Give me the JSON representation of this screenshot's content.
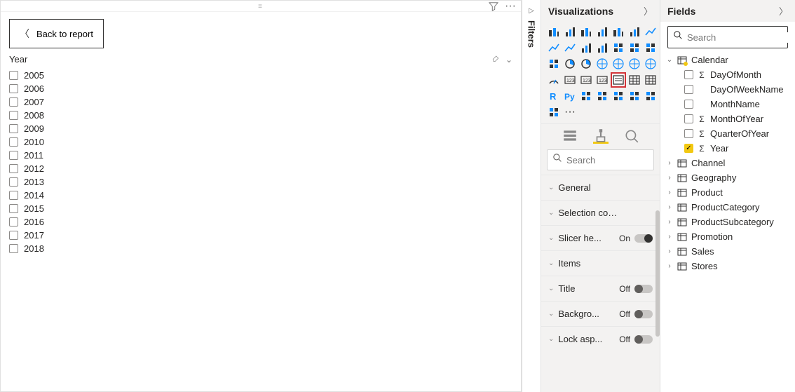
{
  "report": {
    "back_label": "Back to report",
    "slicer_title": "Year",
    "years": [
      "2005",
      "2006",
      "2007",
      "2008",
      "2009",
      "2010",
      "2011",
      "2012",
      "2013",
      "2014",
      "2015",
      "2016",
      "2017",
      "2018"
    ]
  },
  "filters_tab": {
    "label": "Filters"
  },
  "viz": {
    "title": "Visualizations",
    "search_placeholder": "Search",
    "icons": [
      "stacked-bar-chart",
      "stacked-column-chart",
      "clustered-bar-chart",
      "clustered-column-chart",
      "hundred-stacked-bar",
      "hundred-stacked-column",
      "line-chart",
      "area-chart",
      "stacked-area-chart",
      "line-stacked-column",
      "line-clustered-column",
      "ribbon-chart",
      "waterfall-chart",
      "scatter-chart",
      "funnel-chart",
      "pie-chart",
      "donut-chart",
      "treemap",
      "map",
      "filled-map",
      "shape-map",
      "gauge",
      "card",
      "multi-row-card",
      "kpi",
      "slicer",
      "table",
      "matrix",
      "r-visual",
      "python-visual",
      "key-influencers",
      "decomposition-tree",
      "qa-visual",
      "paginated-report",
      "power-apps",
      "power-automate",
      "more"
    ],
    "selected_icon_index": 25,
    "tabs": [
      "fields",
      "format",
      "analytics"
    ],
    "active_tab": "format",
    "format_sections": [
      {
        "label": "General",
        "toggle": null
      },
      {
        "label": "Selection controls",
        "toggle": null
      },
      {
        "label": "Slicer he...",
        "toggle": "On"
      },
      {
        "label": "Items",
        "toggle": null
      },
      {
        "label": "Title",
        "toggle": "Off"
      },
      {
        "label": "Backgro...",
        "toggle": "Off"
      },
      {
        "label": "Lock asp...",
        "toggle": "Off"
      }
    ]
  },
  "fields": {
    "title": "Fields",
    "search_placeholder": "Search",
    "tables": [
      {
        "name": "Calendar",
        "expanded": true,
        "highlighted": true,
        "columns": [
          {
            "name": "DayOfMonth",
            "agg": true,
            "checked": false
          },
          {
            "name": "DayOfWeekName",
            "agg": false,
            "checked": false
          },
          {
            "name": "MonthName",
            "agg": false,
            "checked": false
          },
          {
            "name": "MonthOfYear",
            "agg": true,
            "checked": false
          },
          {
            "name": "QuarterOfYear",
            "agg": true,
            "checked": false
          },
          {
            "name": "Year",
            "agg": true,
            "checked": true
          }
        ]
      },
      {
        "name": "Channel",
        "expanded": false
      },
      {
        "name": "Geography",
        "expanded": false
      },
      {
        "name": "Product",
        "expanded": false
      },
      {
        "name": "ProductCategory",
        "expanded": false
      },
      {
        "name": "ProductSubcategory",
        "expanded": false
      },
      {
        "name": "Promotion",
        "expanded": false
      },
      {
        "name": "Sales",
        "expanded": false
      },
      {
        "name": "Stores",
        "expanded": false
      }
    ]
  }
}
